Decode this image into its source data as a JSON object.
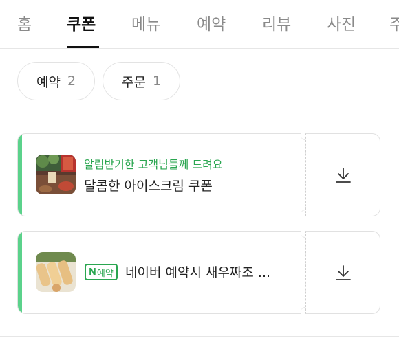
{
  "tabs": [
    {
      "label": "홈"
    },
    {
      "label": "쿠폰"
    },
    {
      "label": "메뉴"
    },
    {
      "label": "예약"
    },
    {
      "label": "리뷰"
    },
    {
      "label": "사진"
    },
    {
      "label": "주"
    }
  ],
  "active_tab": "쿠폰",
  "filters": [
    {
      "label": "예약",
      "count": "2"
    },
    {
      "label": "주문",
      "count": "1"
    }
  ],
  "coupons": [
    {
      "subtitle": "알림받기한 고객님들께 드려요",
      "title": "달콤한 아이스크림 쿠폰",
      "download_icon": "download-icon"
    },
    {
      "badge_n": "N",
      "badge_text": "예약",
      "title": "네이버 예약시 새우짜조 ...",
      "download_icon": "download-icon"
    }
  ],
  "colors": {
    "accent_green": "#2aa650",
    "coupon_bar": "#5bd28b"
  }
}
